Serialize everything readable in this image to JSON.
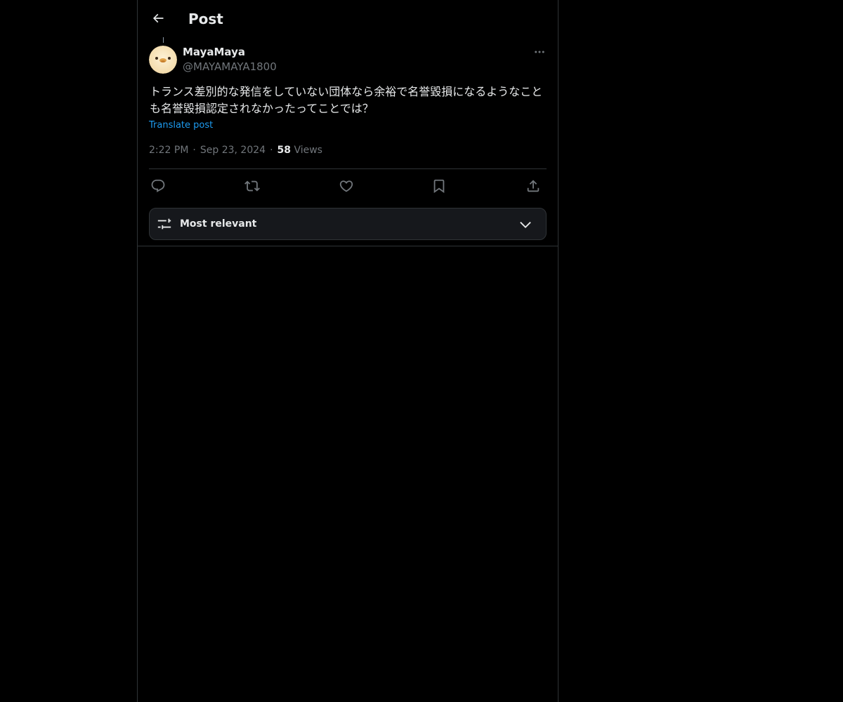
{
  "header": {
    "back_icon": "arrow-left-icon",
    "title": "Post"
  },
  "post": {
    "author": {
      "display_name": "MayaMaya",
      "handle": "@MAYAMAYA1800",
      "avatar_icon": "duck-avatar"
    },
    "more_icon": "ellipsis-icon",
    "text": "トランス差別的な発信をしていない団体なら余裕で名誉毀損になるようなことも名誉毀損認定されなかったってことでは？",
    "translate_label": "Translate post",
    "time": "2:22 PM",
    "date": "Sep 23, 2024",
    "separator": "·",
    "views_count": "58",
    "views_label": "Views"
  },
  "actions": {
    "reply_icon": "reply-icon",
    "repost_icon": "repost-icon",
    "like_icon": "heart-icon",
    "bookmark_icon": "bookmark-icon",
    "share_icon": "share-icon"
  },
  "sort": {
    "icon": "sliders-icon",
    "label": "Most relevant",
    "chevron_icon": "chevron-down-icon"
  },
  "colors": {
    "background": "#000000",
    "text_primary": "#e7e9ea",
    "text_secondary": "#71767b",
    "link": "#1d9bf0",
    "border": "#2f3336",
    "sort_bg": "#16181c"
  }
}
